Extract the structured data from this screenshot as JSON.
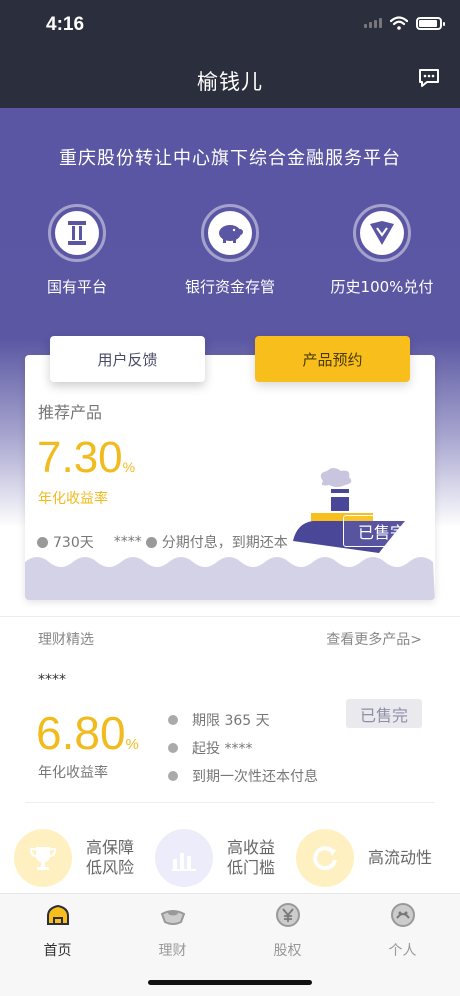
{
  "status": {
    "time": "4:16"
  },
  "nav": {
    "title": "榆钱儿",
    "message_icon": "chat-bubble-icon"
  },
  "hero": {
    "title": "重庆股份转让中心旗下综合金融服务平台",
    "features": [
      {
        "label": "国有平台",
        "icon": "pillar-icon"
      },
      {
        "label": "银行资金存管",
        "icon": "piggy-bank-icon"
      },
      {
        "label": "历史100%兑付",
        "icon": "shield-check-icon"
      }
    ]
  },
  "actions": {
    "feedback_label": "用户反馈",
    "reserve_label": "产品预约"
  },
  "recommended": {
    "heading": "推荐产品",
    "rate": "7.30",
    "rate_suffix": "%",
    "rate_label": "年化收益率",
    "term": "730天",
    "masked": "****",
    "repayment": "分期付息，到期还本",
    "status": "已售完"
  },
  "selected": {
    "title": "理财精选",
    "more_link": "查看更多产品>",
    "product_name": "****",
    "rate": "6.80",
    "rate_suffix": "%",
    "rate_label": "年化收益率",
    "period": "期限 365 天",
    "min_invest": "起投 ****",
    "repayment": "到期一次性还本付息",
    "status": "已售完"
  },
  "bottom_features": [
    {
      "line1": "高保障",
      "line2": "低风险",
      "icon": "trophy-icon",
      "color": "#fff0c2"
    },
    {
      "line1": "高收益",
      "line2": "低门槛",
      "icon": "bar-chart-icon",
      "color": "#ececfa"
    },
    {
      "line1": "高流动性",
      "line2": "",
      "icon": "refresh-icon",
      "color": "#fff0c2"
    }
  ],
  "tabs": [
    {
      "label": "首页",
      "icon": "home-icon",
      "active": true
    },
    {
      "label": "理财",
      "icon": "ingot-icon",
      "active": false
    },
    {
      "label": "股权",
      "icon": "yuan-coin-icon",
      "active": false
    },
    {
      "label": "个人",
      "icon": "user-icon",
      "active": false
    }
  ],
  "colors": {
    "accent": "#f8bf1c",
    "nav_bg": "#2b2e3c",
    "hero": "#5a56a4"
  }
}
